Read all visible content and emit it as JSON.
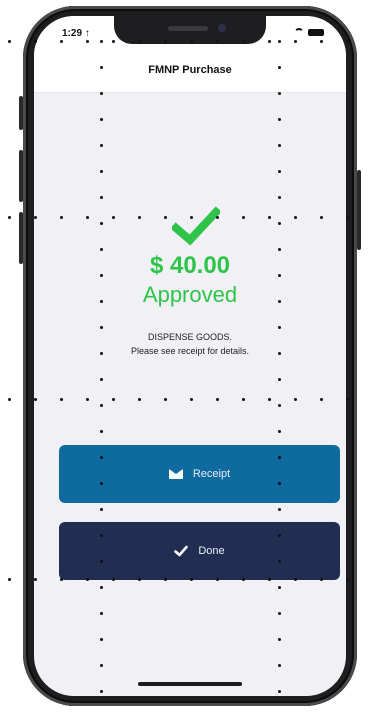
{
  "status_bar": {
    "time": "1:29 ↑"
  },
  "nav": {
    "title": "FMNP Purchase"
  },
  "result": {
    "amount": "$ 40.00",
    "status": "Approved",
    "message_line_1": "DISPENSE GOODS.",
    "message_line_2": "Please see receipt for details."
  },
  "actions": {
    "receipt_label": "Receipt",
    "done_label": "Done"
  },
  "colors": {
    "success_green": "#2ec44a",
    "receipt_blue": "#0f6aa0",
    "done_navy": "#212e52",
    "screen_bg": "#f0f0f5"
  },
  "icons": {
    "status": "checkmark-icon",
    "receipt": "envelope-icon",
    "done": "check-icon"
  }
}
